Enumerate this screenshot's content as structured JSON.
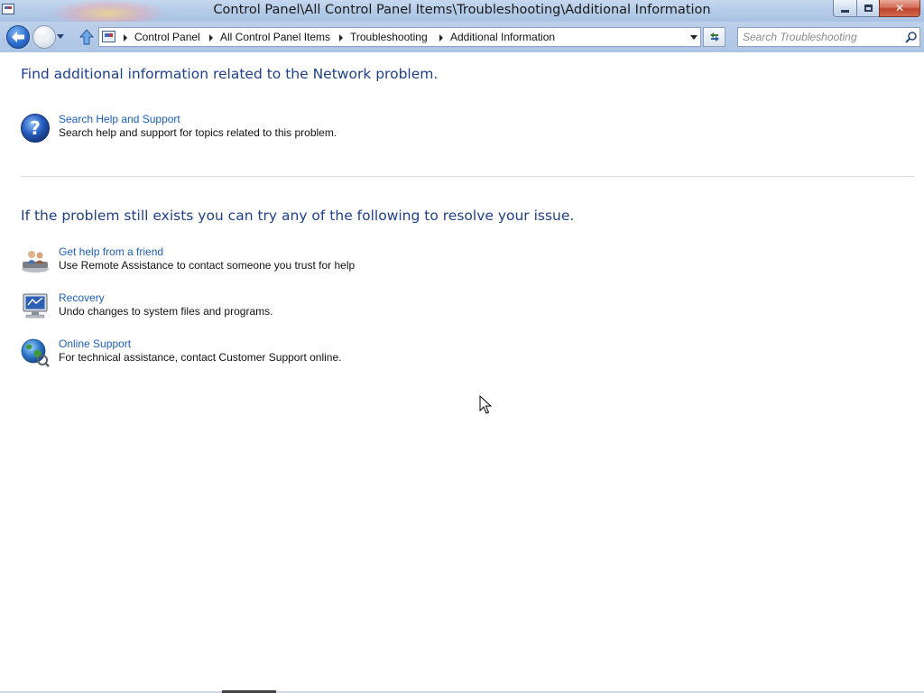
{
  "window": {
    "title": "Control Panel\\All Control Panel Items\\Troubleshooting\\Additional Information",
    "minimize_label": "",
    "close_label": "✕"
  },
  "navigation": {
    "breadcrumbs": [
      "Control Panel",
      "All Control Panel Items",
      "Troubleshooting",
      "Additional Information"
    ],
    "search_placeholder": "Search Troubleshooting"
  },
  "icons": {
    "back": "back-arrow-icon",
    "forward": "forward-arrow-icon",
    "up": "up-arrow-icon",
    "refresh": "refresh-icon",
    "search": "magnifier-icon",
    "help": "help-question-icon",
    "friend": "remote-assistance-icon",
    "recovery": "recovery-computer-icon",
    "online": "globe-online-icon"
  },
  "colors": {
    "heading": "#1e3f8a",
    "link": "#1c5fb8",
    "titlebar": "#b4cbe8"
  },
  "main": {
    "heading1": "Find additional information related to the Network problem.",
    "heading2": "If the problem still exists you can try any of the following to resolve your issue.",
    "items": [
      {
        "title": "Search Help and Support",
        "description": "Search help and support for topics related to this problem."
      },
      {
        "title": "Get help from a friend",
        "description": "Use Remote Assistance to contact someone you trust for help"
      },
      {
        "title": "Recovery",
        "description": "Undo changes to system files and programs."
      },
      {
        "title": "Online Support",
        "description": "For technical assistance, contact Customer Support online."
      }
    ]
  }
}
